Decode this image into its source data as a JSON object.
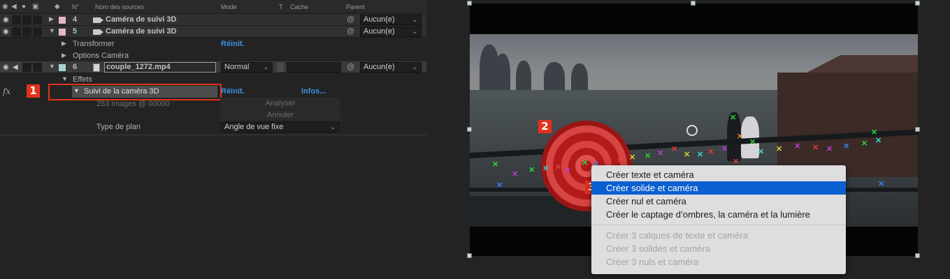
{
  "timeline": {
    "headers": {
      "num": "N°",
      "source": "Nom des sources",
      "mode": "Mode",
      "t": "T",
      "cache": "Cache",
      "parent": "Parent"
    },
    "layers": [
      {
        "num": "4",
        "name": "Caméra de suivi 3D",
        "parent": "Aucun(e)",
        "color": "#e7b7c4"
      },
      {
        "num": "5",
        "name": "Caméra de suivi 3D",
        "parent": "Aucun(e)",
        "color": "#e7b7c4"
      },
      {
        "num": "6",
        "name": "couple_1272.mp4",
        "parent": "Aucun(e)",
        "mode": "Normal",
        "color": "#a8d3d6"
      }
    ],
    "props": {
      "transform": "Transformer",
      "transform_reset": "Réinit.",
      "camera_options": "Options Caméra",
      "effects": "Effets",
      "effect_name": "Suivi de la caméra 3D",
      "effect_reset": "Réinit.",
      "effect_info": "Infos...",
      "fx": "fx",
      "frames": "253 images @ 00000",
      "analyze": "Analyser",
      "cancel": "Annuler",
      "plane_label": "Type de plan",
      "plane_value": "Angle de vue fixe"
    },
    "markers": {
      "m1": "1"
    }
  },
  "viewer": {
    "markers": {
      "m2": "2",
      "m3": "3"
    },
    "track_colors": [
      "#2bd63a",
      "#c13ed8",
      "#3b7ef0",
      "#e43c3c",
      "#d4d233",
      "#3ad6d0",
      "#e88a2b"
    ]
  },
  "context_menu": {
    "items": [
      {
        "label": "Créer texte et caméra",
        "state": "normal"
      },
      {
        "label": "Créer solide et caméra",
        "state": "highlighted"
      },
      {
        "label": "Créer nul et caméra",
        "state": "normal"
      },
      {
        "label": "Créer le captage d’ombres, la caméra et la lumière",
        "state": "normal"
      }
    ],
    "disabled_items": [
      {
        "label": "Créer 3 calques de texte et caméra"
      },
      {
        "label": "Créer 3 solides et caméra"
      },
      {
        "label": "Créer 3 nuls et caméra"
      }
    ]
  }
}
